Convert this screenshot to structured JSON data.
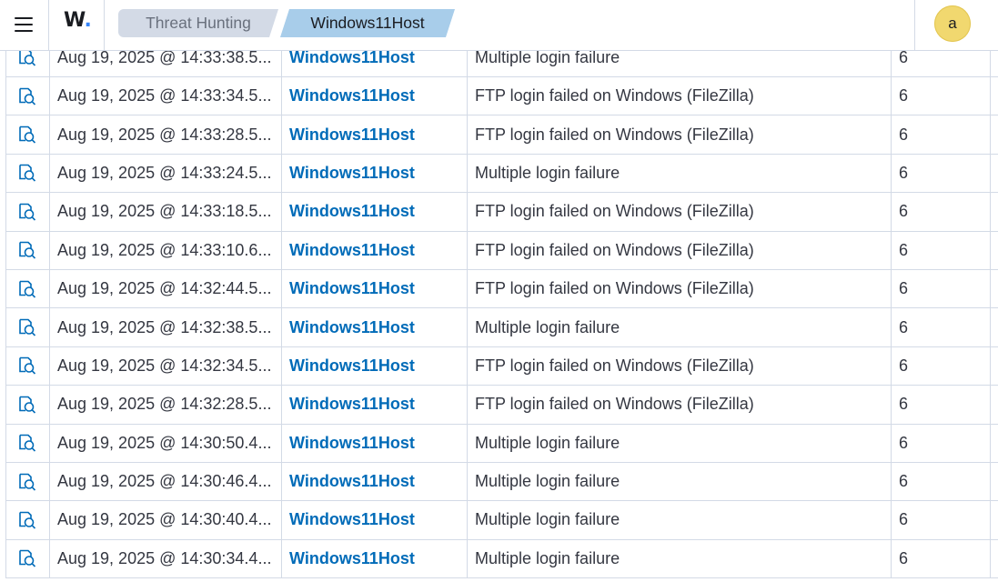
{
  "header": {
    "logo_text": "W",
    "logo_dot": ".",
    "breadcrumbs": [
      "Threat Hunting",
      "Windows11Host"
    ],
    "avatar_letter": "a"
  },
  "icons": {
    "menu": "hamburger-menu-icon",
    "row_action": "inspect-document-icon"
  },
  "colors": {
    "accent": "#006bb8",
    "breadcrumb_active": "#a8cdea",
    "breadcrumb_inactive": "#d3dae6",
    "avatar": "#f1d86f"
  },
  "rows": [
    {
      "timestamp": "Aug 19, 2025 @ 14:33:38.5...",
      "agent": "Windows11Host",
      "description": "Multiple login failure",
      "level": "6"
    },
    {
      "timestamp": "Aug 19, 2025 @ 14:33:34.5...",
      "agent": "Windows11Host",
      "description": "FTP login failed on Windows (FileZilla)",
      "level": "6"
    },
    {
      "timestamp": "Aug 19, 2025 @ 14:33:28.5...",
      "agent": "Windows11Host",
      "description": "FTP login failed on Windows (FileZilla)",
      "level": "6"
    },
    {
      "timestamp": "Aug 19, 2025 @ 14:33:24.5...",
      "agent": "Windows11Host",
      "description": "Multiple login failure",
      "level": "6"
    },
    {
      "timestamp": "Aug 19, 2025 @ 14:33:18.5...",
      "agent": "Windows11Host",
      "description": "FTP login failed on Windows (FileZilla)",
      "level": "6"
    },
    {
      "timestamp": "Aug 19, 2025 @ 14:33:10.6...",
      "agent": "Windows11Host",
      "description": "FTP login failed on Windows (FileZilla)",
      "level": "6"
    },
    {
      "timestamp": "Aug 19, 2025 @ 14:32:44.5...",
      "agent": "Windows11Host",
      "description": "FTP login failed on Windows (FileZilla)",
      "level": "6"
    },
    {
      "timestamp": "Aug 19, 2025 @ 14:32:38.5...",
      "agent": "Windows11Host",
      "description": "Multiple login failure",
      "level": "6"
    },
    {
      "timestamp": "Aug 19, 2025 @ 14:32:34.5...",
      "agent": "Windows11Host",
      "description": "FTP login failed on Windows (FileZilla)",
      "level": "6"
    },
    {
      "timestamp": "Aug 19, 2025 @ 14:32:28.5...",
      "agent": "Windows11Host",
      "description": "FTP login failed on Windows (FileZilla)",
      "level": "6"
    },
    {
      "timestamp": "Aug 19, 2025 @ 14:30:50.4...",
      "agent": "Windows11Host",
      "description": "Multiple login failure",
      "level": "6"
    },
    {
      "timestamp": "Aug 19, 2025 @ 14:30:46.4...",
      "agent": "Windows11Host",
      "description": "Multiple login failure",
      "level": "6"
    },
    {
      "timestamp": "Aug 19, 2025 @ 14:30:40.4...",
      "agent": "Windows11Host",
      "description": "Multiple login failure",
      "level": "6"
    },
    {
      "timestamp": "Aug 19, 2025 @ 14:30:34.4...",
      "agent": "Windows11Host",
      "description": "Multiple login failure",
      "level": "6"
    }
  ]
}
